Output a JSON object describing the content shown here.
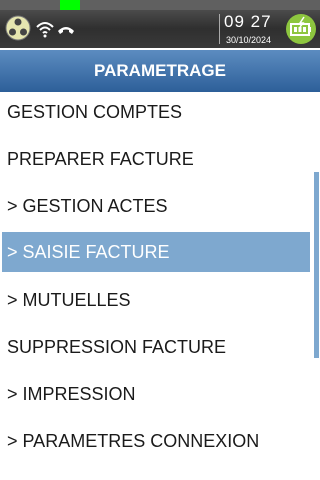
{
  "status": {
    "clock": "09 27",
    "date": "30/10/2024",
    "icons": [
      "network-icon",
      "wifi-icon",
      "phone-hangup-icon",
      "battery-charging-icon"
    ],
    "strip_colors": [
      "#606060",
      "#606060",
      "#606060",
      "#00ff00",
      "#606060",
      "#606060",
      "#606060",
      "#606060",
      "#606060",
      "#606060",
      "#606060",
      "#606060",
      "#606060",
      "#606060",
      "#606060",
      "#606060"
    ]
  },
  "header": {
    "title": "PARAMETRAGE"
  },
  "menu": {
    "items": [
      {
        "label": "GESTION COMPTES",
        "selected": false
      },
      {
        "label": "PREPARER FACTURE",
        "selected": false
      },
      {
        "label": "> GESTION ACTES",
        "selected": false
      },
      {
        "label": "> SAISIE FACTURE",
        "selected": true
      },
      {
        "label": "> MUTUELLES",
        "selected": false
      },
      {
        "label": "SUPPRESSION FACTURE",
        "selected": false
      },
      {
        "label": "> IMPRESSION",
        "selected": false
      },
      {
        "label": "> PARAMETRES CONNEXION",
        "selected": false
      }
    ]
  },
  "colors": {
    "accent": "#2d5f99",
    "selection": "#7ea8cf",
    "battery": "#8dc63f"
  }
}
